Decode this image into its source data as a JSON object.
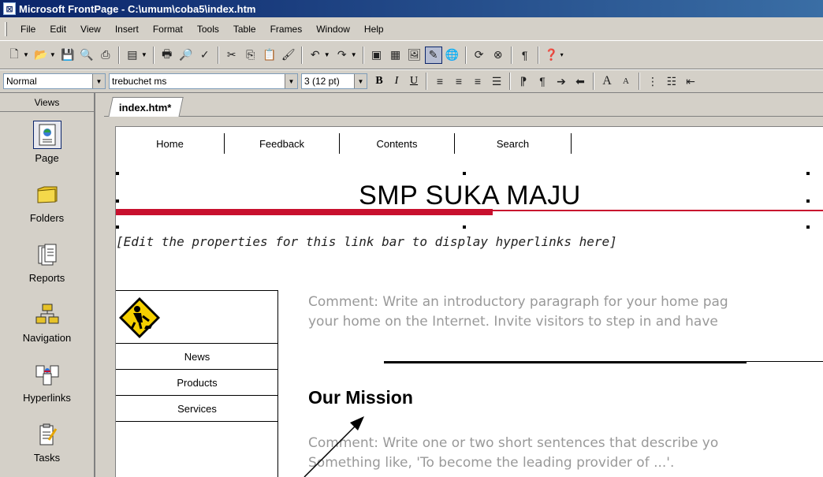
{
  "window": {
    "title": "Microsoft FrontPage - C:\\umum\\coba5\\index.htm"
  },
  "menu": [
    "File",
    "Edit",
    "View",
    "Insert",
    "Format",
    "Tools",
    "Table",
    "Frames",
    "Window",
    "Help"
  ],
  "formatting": {
    "style": "Normal",
    "font": "trebuchet ms",
    "size": "3 (12 pt)"
  },
  "views": {
    "header": "Views",
    "items": [
      {
        "label": "Page",
        "icon": "page-icon"
      },
      {
        "label": "Folders",
        "icon": "folders-icon"
      },
      {
        "label": "Reports",
        "icon": "reports-icon"
      },
      {
        "label": "Navigation",
        "icon": "navigation-icon"
      },
      {
        "label": "Hyperlinks",
        "icon": "hyperlinks-icon"
      },
      {
        "label": "Tasks",
        "icon": "tasks-icon"
      }
    ],
    "selected": "Page"
  },
  "tab": {
    "label": "index.htm*"
  },
  "page": {
    "nav_links": [
      "Home",
      "Feedback",
      "Contents",
      "Search"
    ],
    "banner_title": "SMP SUKA MAJU",
    "linkbar_message": "[Edit the properties for this link bar to display hyperlinks here]",
    "sidebar_items": [
      "News",
      "Products",
      "Services"
    ],
    "comment1_line1": "Comment: Write an introductory paragraph for your home pag",
    "comment1_line2": "your home on the Internet. Invite visitors to step in and have",
    "section_heading": "Our Mission",
    "comment2_line1": "Comment: Write one or two short sentences that describe yo",
    "comment2_line2": "Something like, 'To become the leading provider of ...'."
  },
  "colors": {
    "titlebar": "#0a246a",
    "banner_bar": "#c8102e",
    "comment_text": "#999999"
  }
}
